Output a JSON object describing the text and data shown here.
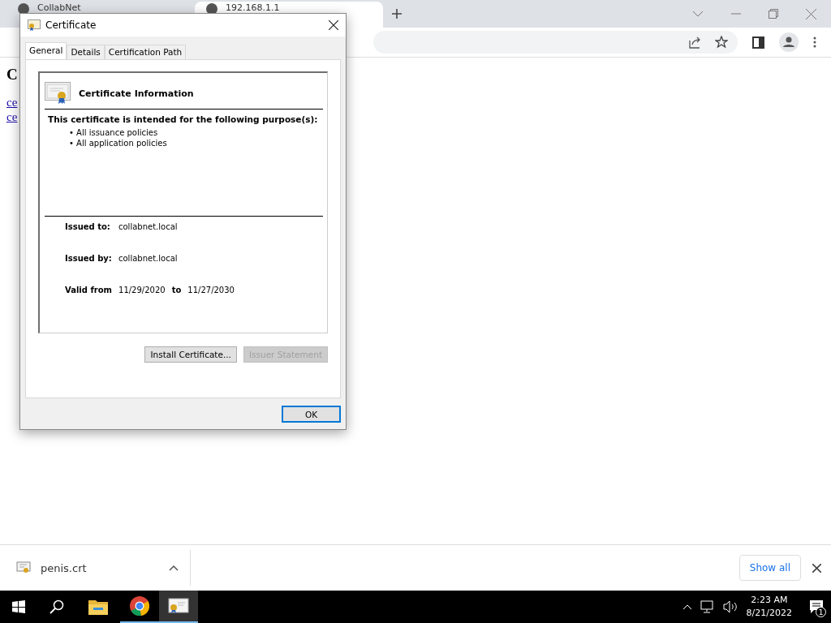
{
  "browser": {
    "tabs": [
      {
        "title": "CollabNet",
        "selected": false
      },
      {
        "title": "192.168.1.1",
        "selected": true
      }
    ],
    "page": {
      "heading": "C",
      "links": [
        "ce",
        "ce"
      ]
    }
  },
  "dialog": {
    "title": "Certificate",
    "tabs": [
      {
        "label": "General",
        "selected": true
      },
      {
        "label": "Details",
        "selected": false
      },
      {
        "label": "Certification Path",
        "selected": false
      }
    ],
    "info_title": "Certificate Information",
    "purpose_heading": "This certificate is intended for the following purpose(s):",
    "purposes": [
      "• All issuance policies",
      "• All application policies"
    ],
    "fields": [
      {
        "label": "Issued to:",
        "value": "collabnet.local"
      },
      {
        "label": "Issued by:",
        "value": "collabnet.local"
      }
    ],
    "validity": {
      "from_label": "Valid from",
      "from": "11/29/2020",
      "to_label": "to",
      "to": "11/27/2030"
    },
    "buttons": [
      {
        "label": "Install Certificate...",
        "disabled": false
      },
      {
        "label": "Issuer Statement",
        "disabled": true
      }
    ],
    "ok": "OK"
  },
  "download_bar": {
    "file": "penis.crt",
    "show_all": "Show all"
  },
  "taskbar": {
    "time": "2:23 AM",
    "date": "8/21/2022",
    "notifications": "1"
  }
}
